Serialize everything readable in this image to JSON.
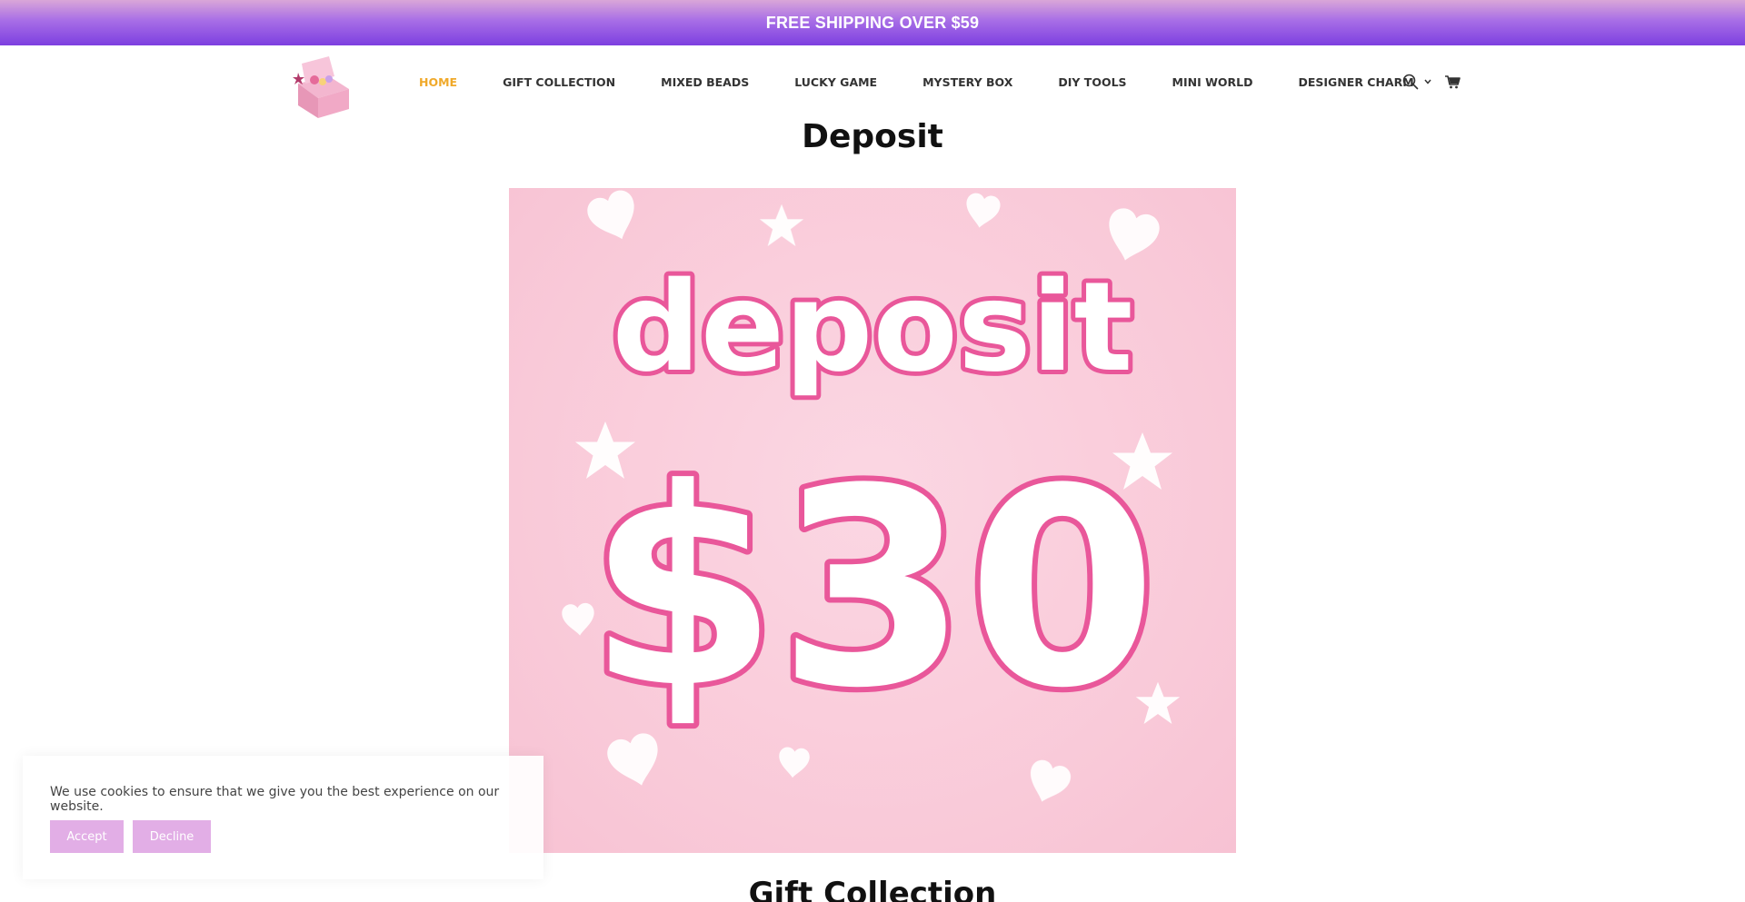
{
  "announcement": {
    "text": "FREE SHIPPING OVER $59"
  },
  "nav": {
    "items": [
      {
        "label": "HOME",
        "active": true
      },
      {
        "label": "GIFT COLLECTION"
      },
      {
        "label": "MIXED BEADS"
      },
      {
        "label": "LUCKY GAME"
      },
      {
        "label": "MYSTERY BOX"
      },
      {
        "label": "DIY TOOLS"
      },
      {
        "label": "MINI WORLD"
      },
      {
        "label": "DESIGNER CHARM",
        "has_dropdown": true
      }
    ],
    "active_color": "#f0a92a"
  },
  "header_icons": [
    "search-icon",
    "cart-icon"
  ],
  "page": {
    "title": "Deposit"
  },
  "hero": {
    "line1": "deposit",
    "line2": "$30",
    "bg_color": "#f9c9d8",
    "outline_color": "#e9579a"
  },
  "next_section": {
    "title": "Gift Collection"
  },
  "cookie": {
    "message": "We use cookies to ensure that we give you the best experience on our website.",
    "accept_label": "Accept",
    "decline_label": "Decline",
    "button_color": "#e2aee6"
  }
}
